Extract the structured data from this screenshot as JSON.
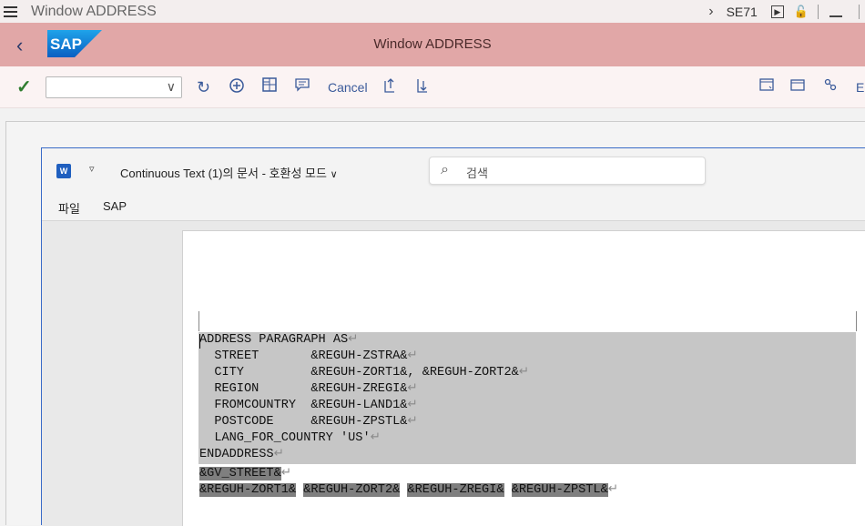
{
  "titlebar": {
    "title": "Window ADDRESS",
    "tcode": "SE71"
  },
  "header": {
    "window_title": "Window ADDRESS",
    "logo_text": "SAP"
  },
  "toolbar": {
    "command_value": "",
    "cancel_label": "Cancel",
    "right_more": "E"
  },
  "word": {
    "app_icon_letter": "W",
    "doc_title": "Continuous Text (1)의 문서  -  호환성 모드",
    "search_placeholder": "검색",
    "menu": [
      "파일",
      "SAP"
    ]
  },
  "document": {
    "lines": [
      "ADDRESS PARAGRAPH AS",
      "  STREET       &REGUH-ZSTRA&",
      "  CITY         &REGUH-ZORT1&, &REGUH-ZORT2&",
      "  REGION       &REGUH-ZREGI&",
      "  FROMCOUNTRY  &REGUH-LAND1&",
      "  POSTCODE     &REGUH-ZPSTL&",
      "  LANG_FOR_COUNTRY 'US'",
      "ENDADDRESS"
    ],
    "gv_street": "&GV_STREET&",
    "last_line_fields": [
      "&REGUH-ZORT1&",
      "&REGUH-ZORT2&",
      "&REGUH-ZREGI&",
      "&REGUH-ZPSTL&"
    ],
    "paragraph_mark": "↵"
  },
  "colors": {
    "sap_header": "#e1a7a7",
    "toolbar_bg": "#fbf3f3",
    "selection": "#c6c6c6",
    "field_highlight": "#7f7f7f",
    "accent_blue": "#3a5a9a"
  }
}
